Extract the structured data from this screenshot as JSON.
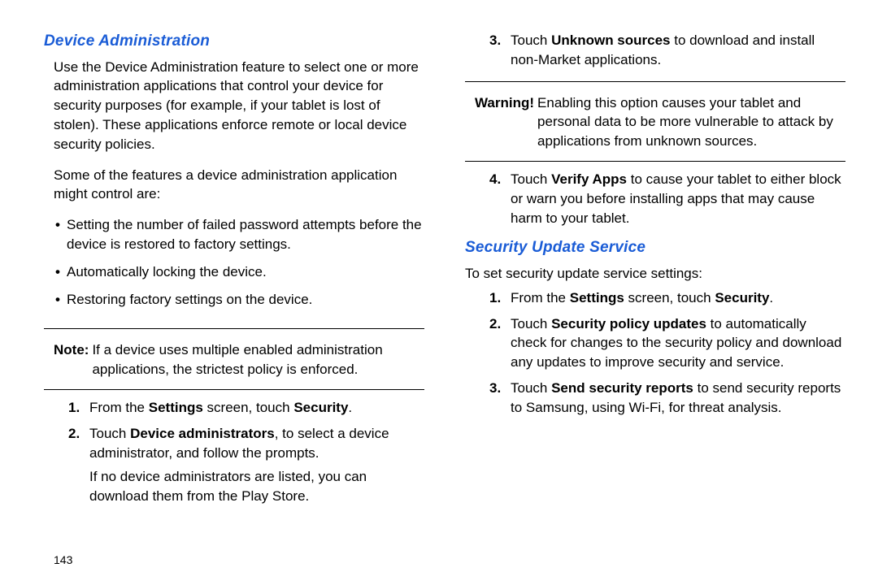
{
  "leftCol": {
    "heading": "Device Administration",
    "intro": "Use the Device Administration feature to select one or more administration applications that control your device for security purposes (for example, if your tablet is lost of stolen). These applications enforce remote or local device security policies.",
    "featuresLead": "Some of the features a device administration application might control are:",
    "bullets": [
      "Setting the number of failed password attempts before the device is restored to factory settings.",
      "Automatically locking the device.",
      "Restoring factory settings on the device."
    ],
    "noteLabel": "Note:",
    "noteText": "If a device uses multiple enabled administration applications, the strictest policy is enforced.",
    "step1_a": "From the ",
    "step1_b": "Settings",
    "step1_c": " screen, touch ",
    "step1_d": "Security",
    "step1_e": ".",
    "step2_a": "Touch ",
    "step2_b": "Device administrators",
    "step2_c": ", to select a device administrator, and follow the prompts.",
    "step2_sub": "If no device administrators are listed, you can download them from the Play Store.",
    "pageNum": "143"
  },
  "rightCol": {
    "step3_a": "Touch ",
    "step3_b": "Unknown sources",
    "step3_c": " to download and install non-Market applications.",
    "warnLabel": "Warning!",
    "warnText": "Enabling this option causes your tablet and personal data to be more vulnerable to attack by applications from unknown sources.",
    "step4_a": "Touch ",
    "step4_b": "Verify Apps",
    "step4_c": " to cause your tablet to either block or warn you before installing apps that may cause harm to your tablet.",
    "heading2": "Security Update Service",
    "intro2": "To set security update service settings:",
    "s1_a": "From the ",
    "s1_b": "Settings",
    "s1_c": " screen, touch ",
    "s1_d": "Security",
    "s1_e": ".",
    "s2_a": "Touch ",
    "s2_b": "Security policy updates",
    "s2_c": " to automatically check for changes to the security policy and download any updates to improve security and service.",
    "s3_a": "Touch ",
    "s3_b": "Send security reports",
    "s3_c": " to send security reports to Samsung, using Wi-Fi, for threat analysis."
  }
}
